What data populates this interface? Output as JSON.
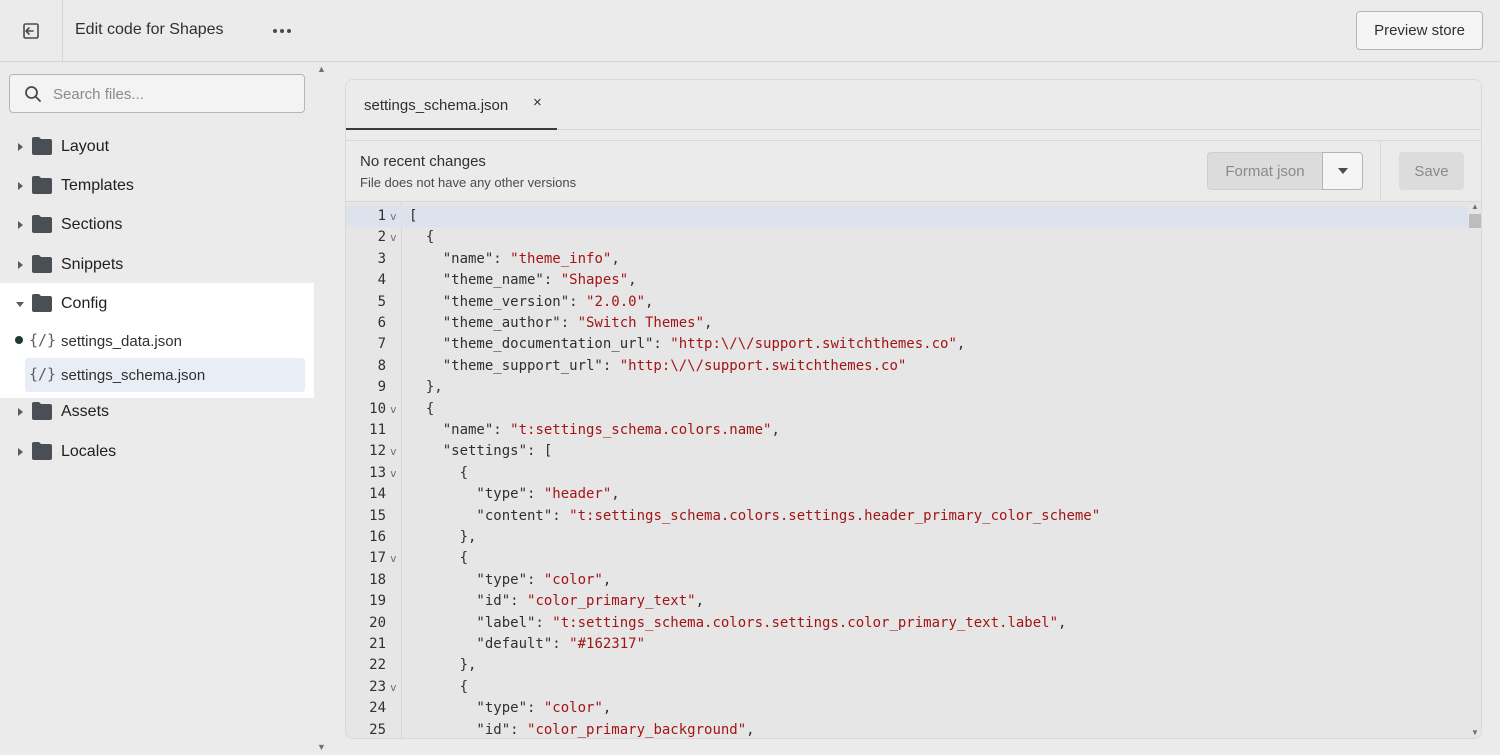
{
  "topbar": {
    "title": "Edit code for Shapes",
    "preview_label": "Preview store"
  },
  "sidebar": {
    "search_placeholder": "Search files...",
    "folders_top": [
      {
        "label": "Layout"
      },
      {
        "label": "Templates"
      },
      {
        "label": "Sections"
      },
      {
        "label": "Snippets"
      }
    ],
    "config": {
      "label": "Config",
      "files": [
        {
          "label": "settings_data.json",
          "modified": true
        },
        {
          "label": "settings_schema.json",
          "modified": false,
          "active": true
        }
      ]
    },
    "folders_bottom": [
      {
        "label": "Assets"
      },
      {
        "label": "Locales"
      }
    ]
  },
  "editor": {
    "tab": {
      "label": "settings_schema.json",
      "close": "×"
    },
    "info": {
      "title": "No recent changes",
      "subtitle": "File does not have any other versions"
    },
    "format_label": "Format json",
    "save_label": "Save",
    "lines": [
      {
        "n": "1",
        "fold": true,
        "text": "["
      },
      {
        "n": "2",
        "fold": true,
        "text": "  {"
      },
      {
        "n": "3",
        "fold": false,
        "text": "    \"name\": \"theme_info\","
      },
      {
        "n": "4",
        "fold": false,
        "text": "    \"theme_name\": \"Shapes\","
      },
      {
        "n": "5",
        "fold": false,
        "text": "    \"theme_version\": \"2.0.0\","
      },
      {
        "n": "6",
        "fold": false,
        "text": "    \"theme_author\": \"Switch Themes\","
      },
      {
        "n": "7",
        "fold": false,
        "text": "    \"theme_documentation_url\": \"http:\\/\\/support.switchthemes.co\","
      },
      {
        "n": "8",
        "fold": false,
        "text": "    \"theme_support_url\": \"http:\\/\\/support.switchthemes.co\""
      },
      {
        "n": "9",
        "fold": false,
        "text": "  },"
      },
      {
        "n": "10",
        "fold": true,
        "text": "  {"
      },
      {
        "n": "11",
        "fold": false,
        "text": "    \"name\": \"t:settings_schema.colors.name\","
      },
      {
        "n": "12",
        "fold": true,
        "text": "    \"settings\": ["
      },
      {
        "n": "13",
        "fold": true,
        "text": "      {"
      },
      {
        "n": "14",
        "fold": false,
        "text": "        \"type\": \"header\","
      },
      {
        "n": "15",
        "fold": false,
        "text": "        \"content\": \"t:settings_schema.colors.settings.header_primary_color_scheme\""
      },
      {
        "n": "16",
        "fold": false,
        "text": "      },"
      },
      {
        "n": "17",
        "fold": true,
        "text": "      {"
      },
      {
        "n": "18",
        "fold": false,
        "text": "        \"type\": \"color\","
      },
      {
        "n": "19",
        "fold": false,
        "text": "        \"id\": \"color_primary_text\","
      },
      {
        "n": "20",
        "fold": false,
        "text": "        \"label\": \"t:settings_schema.colors.settings.color_primary_text.label\","
      },
      {
        "n": "21",
        "fold": false,
        "text": "        \"default\": \"#162317\""
      },
      {
        "n": "22",
        "fold": false,
        "text": "      },"
      },
      {
        "n": "23",
        "fold": true,
        "text": "      {"
      },
      {
        "n": "24",
        "fold": false,
        "text": "        \"type\": \"color\","
      },
      {
        "n": "25",
        "fold": false,
        "text": "        \"id\": \"color_primary_background\","
      }
    ]
  },
  "colors": {
    "string": "#a31515",
    "text": "#303030",
    "current_line": "#dce3ec"
  }
}
